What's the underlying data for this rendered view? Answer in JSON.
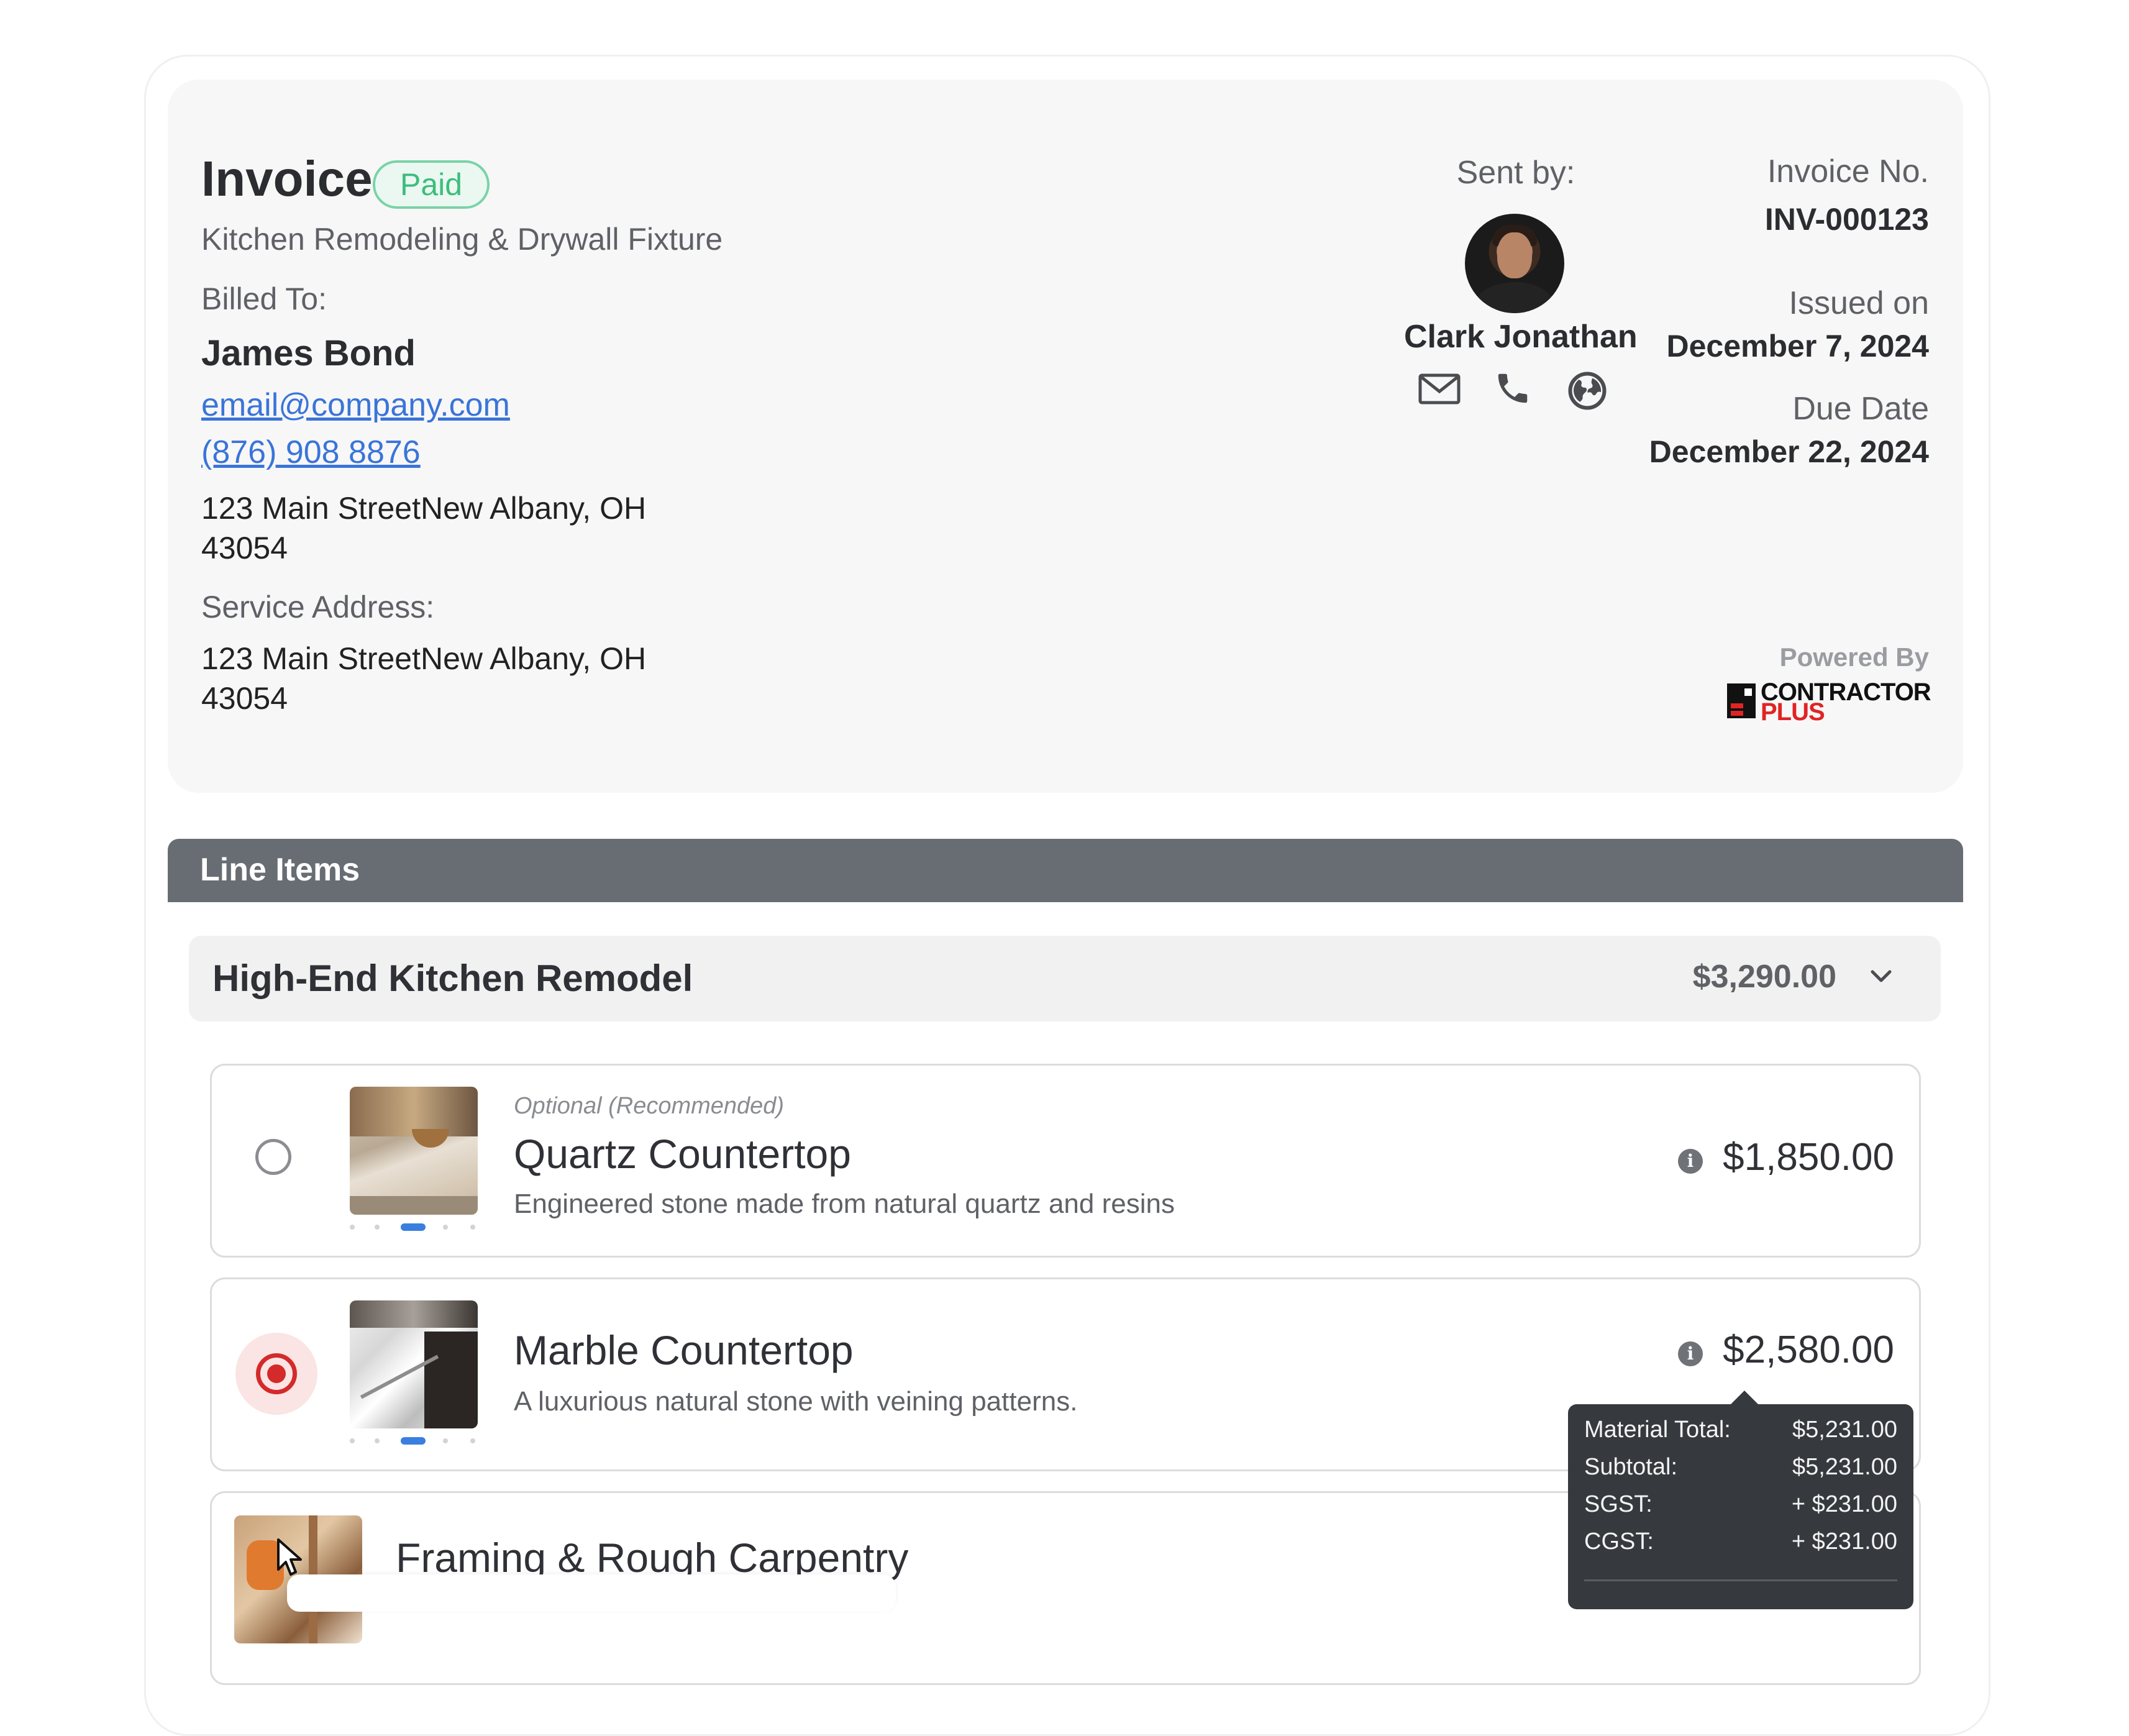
{
  "invoice": {
    "title": "Invoice",
    "status": "Paid",
    "project": "Kitchen Remodeling & Drywall Fixture",
    "billed_to_label": "Billed To:",
    "client_name": "James Bond",
    "client_email": "email@company.com",
    "client_phone": "(876) 908 8876",
    "billing_address_line1": "123 Main StreetNew Albany, OH",
    "billing_address_line2": "43054",
    "service_address_label": "Service Address:",
    "service_address_line1": "123 Main StreetNew Albany, OH",
    "service_address_line2": "43054"
  },
  "sender": {
    "label": "Sent by:",
    "name": "Clark Jonathan",
    "icons": [
      "envelope-icon",
      "phone-icon",
      "globe-icon"
    ]
  },
  "meta": {
    "invoice_no_label": "Invoice No.",
    "invoice_no": "INV-000123",
    "issued_label": "Issued on",
    "issued_date": "December 7, 2024",
    "due_label": "Due Date",
    "due_date": "December 22, 2024"
  },
  "branding": {
    "powered_by": "Powered By",
    "logo_line1": "CONTRACTOR",
    "logo_line2": "PLUS"
  },
  "line_items": {
    "section_title": "Line Items",
    "group": {
      "title": "High-End Kitchen Remodel",
      "total": "$3,290.00"
    },
    "items": [
      {
        "tag": "Optional (Recommended)",
        "name": "Quartz Countertop",
        "description": "Engineered stone made from natural quartz and resins",
        "price": "$1,850.00",
        "selected": false
      },
      {
        "tag": "",
        "name": "Marble Countertop",
        "description": "A luxurious natural stone with veining patterns.",
        "price": "$2,580.00",
        "selected": true
      },
      {
        "tag": "",
        "name": "Framing & Rough Carpentry",
        "description": "",
        "price": "",
        "selected": false
      }
    ]
  },
  "tooltip": {
    "rows": [
      {
        "label": "Material Total:",
        "value": "$5,231.00"
      },
      {
        "label": "Subtotal:",
        "value": "$5,231.00"
      },
      {
        "label": "SGST:",
        "value": "+ $231.00"
      },
      {
        "label": "CGST:",
        "value": "+ $231.00"
      }
    ]
  },
  "colors": {
    "paid_green": "#3dbd7d",
    "link_blue": "#3a74d9",
    "section_bar": "#686d73",
    "selected_red": "#d42a2a",
    "tooltip_bg": "#36393d"
  }
}
